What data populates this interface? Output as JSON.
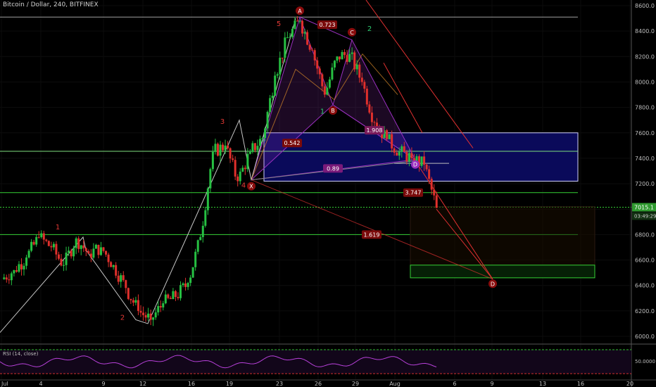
{
  "header": {
    "title": "Bitcoin / Dollar, 240, BITFINEX"
  },
  "price_axis": {
    "ticks": [
      "8600.0",
      "8400.0",
      "8200.0",
      "8000.0",
      "7800.0",
      "7600.0",
      "7400.0",
      "7200.0",
      "7000.0",
      "6800.0",
      "6600.0",
      "6400.0",
      "6200.0",
      "6000.0"
    ],
    "current_price": "7015.1",
    "countdown": "03:49:29"
  },
  "time_axis": {
    "labels": [
      "Jul",
      "4",
      "9",
      "12",
      "16",
      "19",
      "23",
      "26",
      "29",
      "Aug",
      "6",
      "9",
      "13",
      "16",
      "20"
    ]
  },
  "rsi": {
    "label": "RSI (14, close)",
    "level": "50.0000"
  },
  "waves": [
    "1",
    "2",
    "3",
    "4",
    "5",
    "1",
    "2"
  ],
  "pattern_points": [
    "X",
    "A",
    "B",
    "C",
    "D",
    "D"
  ],
  "ratios": [
    "0.723",
    "0.542",
    "1.908",
    "0.89",
    "3.747",
    "1.619"
  ],
  "colors": {
    "background": "#000000",
    "up_candle": "#26c042",
    "down_candle": "#e0302c",
    "pattern": "#9a30c0",
    "zone_fill": "#0a0a5a",
    "level_line": "#35d035",
    "arrow": "#e03030",
    "label_bg": "#7a0a0a",
    "wave_red": "#e53935",
    "wave_green": "#2ecc71"
  },
  "chart_data": {
    "type": "candlestick",
    "title": "Bitcoin / Dollar, 240, BITFINEX",
    "ylim": [
      5950,
      8650
    ],
    "price_path": [
      [
        0,
        6450
      ],
      [
        1,
        6520
      ],
      [
        2,
        6620
      ],
      [
        3,
        6780
      ],
      [
        4,
        6700
      ],
      [
        5,
        6560
      ],
      [
        6,
        6770
      ],
      [
        7,
        6650
      ],
      [
        8,
        6700
      ],
      [
        9,
        6560
      ],
      [
        10,
        6380
      ],
      [
        11,
        6200
      ],
      [
        12,
        6130
      ],
      [
        13,
        6260
      ],
      [
        14,
        6310
      ],
      [
        15,
        6420
      ],
      [
        16,
        6780
      ],
      [
        17,
        7450
      ],
      [
        18,
        7500
      ],
      [
        19,
        7220
      ],
      [
        20,
        7450
      ],
      [
        21,
        7560
      ],
      [
        22,
        8050
      ],
      [
        23,
        8350
      ],
      [
        24,
        8480
      ],
      [
        25,
        8250
      ],
      [
        26,
        7900
      ],
      [
        27,
        8200
      ],
      [
        28,
        8220
      ],
      [
        29,
        8000
      ],
      [
        30,
        7680
      ],
      [
        31,
        7550
      ],
      [
        32,
        7450
      ],
      [
        33,
        7400
      ],
      [
        34,
        7350
      ],
      [
        35,
        7010
      ]
    ],
    "levels": [
      8510,
      7455,
      7130,
      7015,
      6800
    ],
    "zone": [
      7220,
      7600
    ],
    "target_zone": [
      6460,
      6560
    ]
  }
}
